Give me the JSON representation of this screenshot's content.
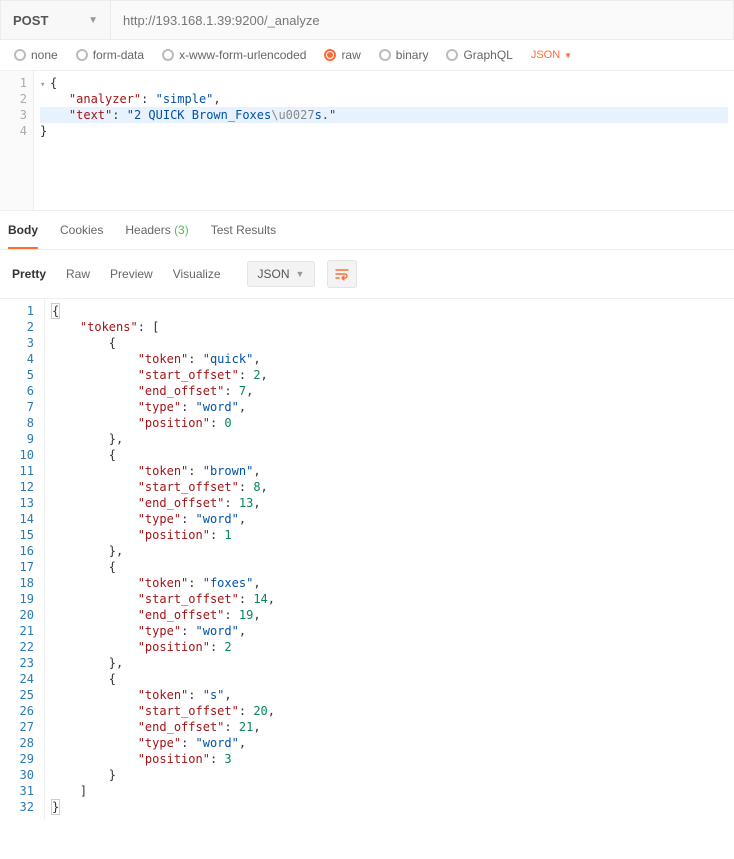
{
  "request": {
    "method": "POST",
    "url": "http://193.168.1.39:9200/_analyze"
  },
  "bodyTypes": {
    "options": [
      "none",
      "form-data",
      "x-www-form-urlencoded",
      "raw",
      "binary",
      "GraphQL"
    ],
    "selected": "raw",
    "rawFormat": "JSON"
  },
  "requestBody": {
    "lines": [
      {
        "n": "1",
        "fold": "▾",
        "tokens": [
          {
            "t": "pun",
            "v": "{"
          }
        ]
      },
      {
        "n": "2",
        "tokens": [
          {
            "t": "ind",
            "v": "    "
          },
          {
            "t": "key",
            "v": "\"analyzer\""
          },
          {
            "t": "pun",
            "v": ": "
          },
          {
            "t": "str",
            "v": "\"simple\""
          },
          {
            "t": "pun",
            "v": ","
          }
        ]
      },
      {
        "n": "3",
        "hl": true,
        "tokens": [
          {
            "t": "ind",
            "v": "    "
          },
          {
            "t": "key",
            "v": "\"text\""
          },
          {
            "t": "pun",
            "v": ": "
          },
          {
            "t": "str",
            "v": "\"2 QUICK Brown_Foxes"
          },
          {
            "t": "esc",
            "v": "\\u0027"
          },
          {
            "t": "str",
            "v": "s.\""
          }
        ]
      },
      {
        "n": "4",
        "tokens": [
          {
            "t": "pun",
            "v": "}"
          }
        ]
      }
    ]
  },
  "responseTabs": {
    "tabs": [
      {
        "label": "Body",
        "active": true
      },
      {
        "label": "Cookies"
      },
      {
        "label": "Headers",
        "count": "(3)"
      },
      {
        "label": "Test Results"
      }
    ]
  },
  "viewModes": {
    "modes": [
      "Pretty",
      "Raw",
      "Preview",
      "Visualize"
    ],
    "active": "Pretty",
    "format": "JSON"
  },
  "responseBody": {
    "lines": [
      {
        "n": "1",
        "tokens": [
          {
            "t": "rpun",
            "v": "{",
            "box": true
          }
        ]
      },
      {
        "n": "2",
        "tokens": [
          {
            "t": "ind",
            "v": "    "
          },
          {
            "t": "rkey",
            "v": "\"tokens\""
          },
          {
            "t": "rpun",
            "v": ": ["
          }
        ]
      },
      {
        "n": "3",
        "tokens": [
          {
            "t": "ind",
            "v": "        "
          },
          {
            "t": "rpun",
            "v": "{"
          }
        ]
      },
      {
        "n": "4",
        "tokens": [
          {
            "t": "ind",
            "v": "            "
          },
          {
            "t": "rkey",
            "v": "\"token\""
          },
          {
            "t": "rpun",
            "v": ": "
          },
          {
            "t": "rstr",
            "v": "\"quick\""
          },
          {
            "t": "rpun",
            "v": ","
          }
        ]
      },
      {
        "n": "5",
        "tokens": [
          {
            "t": "ind",
            "v": "            "
          },
          {
            "t": "rkey",
            "v": "\"start_offset\""
          },
          {
            "t": "rpun",
            "v": ": "
          },
          {
            "t": "rnum",
            "v": "2"
          },
          {
            "t": "rpun",
            "v": ","
          }
        ]
      },
      {
        "n": "6",
        "tokens": [
          {
            "t": "ind",
            "v": "            "
          },
          {
            "t": "rkey",
            "v": "\"end_offset\""
          },
          {
            "t": "rpun",
            "v": ": "
          },
          {
            "t": "rnum",
            "v": "7"
          },
          {
            "t": "rpun",
            "v": ","
          }
        ]
      },
      {
        "n": "7",
        "tokens": [
          {
            "t": "ind",
            "v": "            "
          },
          {
            "t": "rkey",
            "v": "\"type\""
          },
          {
            "t": "rpun",
            "v": ": "
          },
          {
            "t": "rstr",
            "v": "\"word\""
          },
          {
            "t": "rpun",
            "v": ","
          }
        ]
      },
      {
        "n": "8",
        "tokens": [
          {
            "t": "ind",
            "v": "            "
          },
          {
            "t": "rkey",
            "v": "\"position\""
          },
          {
            "t": "rpun",
            "v": ": "
          },
          {
            "t": "rnum",
            "v": "0"
          }
        ]
      },
      {
        "n": "9",
        "tokens": [
          {
            "t": "ind",
            "v": "        "
          },
          {
            "t": "rpun",
            "v": "},"
          }
        ]
      },
      {
        "n": "10",
        "tokens": [
          {
            "t": "ind",
            "v": "        "
          },
          {
            "t": "rpun",
            "v": "{"
          }
        ]
      },
      {
        "n": "11",
        "tokens": [
          {
            "t": "ind",
            "v": "            "
          },
          {
            "t": "rkey",
            "v": "\"token\""
          },
          {
            "t": "rpun",
            "v": ": "
          },
          {
            "t": "rstr",
            "v": "\"brown\""
          },
          {
            "t": "rpun",
            "v": ","
          }
        ]
      },
      {
        "n": "12",
        "tokens": [
          {
            "t": "ind",
            "v": "            "
          },
          {
            "t": "rkey",
            "v": "\"start_offset\""
          },
          {
            "t": "rpun",
            "v": ": "
          },
          {
            "t": "rnum",
            "v": "8"
          },
          {
            "t": "rpun",
            "v": ","
          }
        ]
      },
      {
        "n": "13",
        "tokens": [
          {
            "t": "ind",
            "v": "            "
          },
          {
            "t": "rkey",
            "v": "\"end_offset\""
          },
          {
            "t": "rpun",
            "v": ": "
          },
          {
            "t": "rnum",
            "v": "13"
          },
          {
            "t": "rpun",
            "v": ","
          }
        ]
      },
      {
        "n": "14",
        "tokens": [
          {
            "t": "ind",
            "v": "            "
          },
          {
            "t": "rkey",
            "v": "\"type\""
          },
          {
            "t": "rpun",
            "v": ": "
          },
          {
            "t": "rstr",
            "v": "\"word\""
          },
          {
            "t": "rpun",
            "v": ","
          }
        ]
      },
      {
        "n": "15",
        "tokens": [
          {
            "t": "ind",
            "v": "            "
          },
          {
            "t": "rkey",
            "v": "\"position\""
          },
          {
            "t": "rpun",
            "v": ": "
          },
          {
            "t": "rnum",
            "v": "1"
          }
        ]
      },
      {
        "n": "16",
        "tokens": [
          {
            "t": "ind",
            "v": "        "
          },
          {
            "t": "rpun",
            "v": "},"
          }
        ]
      },
      {
        "n": "17",
        "tokens": [
          {
            "t": "ind",
            "v": "        "
          },
          {
            "t": "rpun",
            "v": "{"
          }
        ]
      },
      {
        "n": "18",
        "tokens": [
          {
            "t": "ind",
            "v": "            "
          },
          {
            "t": "rkey",
            "v": "\"token\""
          },
          {
            "t": "rpun",
            "v": ": "
          },
          {
            "t": "rstr",
            "v": "\"foxes\""
          },
          {
            "t": "rpun",
            "v": ","
          }
        ]
      },
      {
        "n": "19",
        "tokens": [
          {
            "t": "ind",
            "v": "            "
          },
          {
            "t": "rkey",
            "v": "\"start_offset\""
          },
          {
            "t": "rpun",
            "v": ": "
          },
          {
            "t": "rnum",
            "v": "14"
          },
          {
            "t": "rpun",
            "v": ","
          }
        ]
      },
      {
        "n": "20",
        "tokens": [
          {
            "t": "ind",
            "v": "            "
          },
          {
            "t": "rkey",
            "v": "\"end_offset\""
          },
          {
            "t": "rpun",
            "v": ": "
          },
          {
            "t": "rnum",
            "v": "19"
          },
          {
            "t": "rpun",
            "v": ","
          }
        ]
      },
      {
        "n": "21",
        "tokens": [
          {
            "t": "ind",
            "v": "            "
          },
          {
            "t": "rkey",
            "v": "\"type\""
          },
          {
            "t": "rpun",
            "v": ": "
          },
          {
            "t": "rstr",
            "v": "\"word\""
          },
          {
            "t": "rpun",
            "v": ","
          }
        ]
      },
      {
        "n": "22",
        "tokens": [
          {
            "t": "ind",
            "v": "            "
          },
          {
            "t": "rkey",
            "v": "\"position\""
          },
          {
            "t": "rpun",
            "v": ": "
          },
          {
            "t": "rnum",
            "v": "2"
          }
        ]
      },
      {
        "n": "23",
        "tokens": [
          {
            "t": "ind",
            "v": "        "
          },
          {
            "t": "rpun",
            "v": "},"
          }
        ]
      },
      {
        "n": "24",
        "tokens": [
          {
            "t": "ind",
            "v": "        "
          },
          {
            "t": "rpun",
            "v": "{"
          }
        ]
      },
      {
        "n": "25",
        "tokens": [
          {
            "t": "ind",
            "v": "            "
          },
          {
            "t": "rkey",
            "v": "\"token\""
          },
          {
            "t": "rpun",
            "v": ": "
          },
          {
            "t": "rstr",
            "v": "\"s\""
          },
          {
            "t": "rpun",
            "v": ","
          }
        ]
      },
      {
        "n": "26",
        "tokens": [
          {
            "t": "ind",
            "v": "            "
          },
          {
            "t": "rkey",
            "v": "\"start_offset\""
          },
          {
            "t": "rpun",
            "v": ": "
          },
          {
            "t": "rnum",
            "v": "20"
          },
          {
            "t": "rpun",
            "v": ","
          }
        ]
      },
      {
        "n": "27",
        "tokens": [
          {
            "t": "ind",
            "v": "            "
          },
          {
            "t": "rkey",
            "v": "\"end_offset\""
          },
          {
            "t": "rpun",
            "v": ": "
          },
          {
            "t": "rnum",
            "v": "21"
          },
          {
            "t": "rpun",
            "v": ","
          }
        ]
      },
      {
        "n": "28",
        "tokens": [
          {
            "t": "ind",
            "v": "            "
          },
          {
            "t": "rkey",
            "v": "\"type\""
          },
          {
            "t": "rpun",
            "v": ": "
          },
          {
            "t": "rstr",
            "v": "\"word\""
          },
          {
            "t": "rpun",
            "v": ","
          }
        ]
      },
      {
        "n": "29",
        "tokens": [
          {
            "t": "ind",
            "v": "            "
          },
          {
            "t": "rkey",
            "v": "\"position\""
          },
          {
            "t": "rpun",
            "v": ": "
          },
          {
            "t": "rnum",
            "v": "3"
          }
        ]
      },
      {
        "n": "30",
        "tokens": [
          {
            "t": "ind",
            "v": "        "
          },
          {
            "t": "rpun",
            "v": "}"
          }
        ]
      },
      {
        "n": "31",
        "tokens": [
          {
            "t": "ind",
            "v": "    "
          },
          {
            "t": "rpun",
            "v": "]"
          }
        ]
      },
      {
        "n": "32",
        "tokens": [
          {
            "t": "rpun",
            "v": "}",
            "box": true
          }
        ]
      }
    ]
  }
}
